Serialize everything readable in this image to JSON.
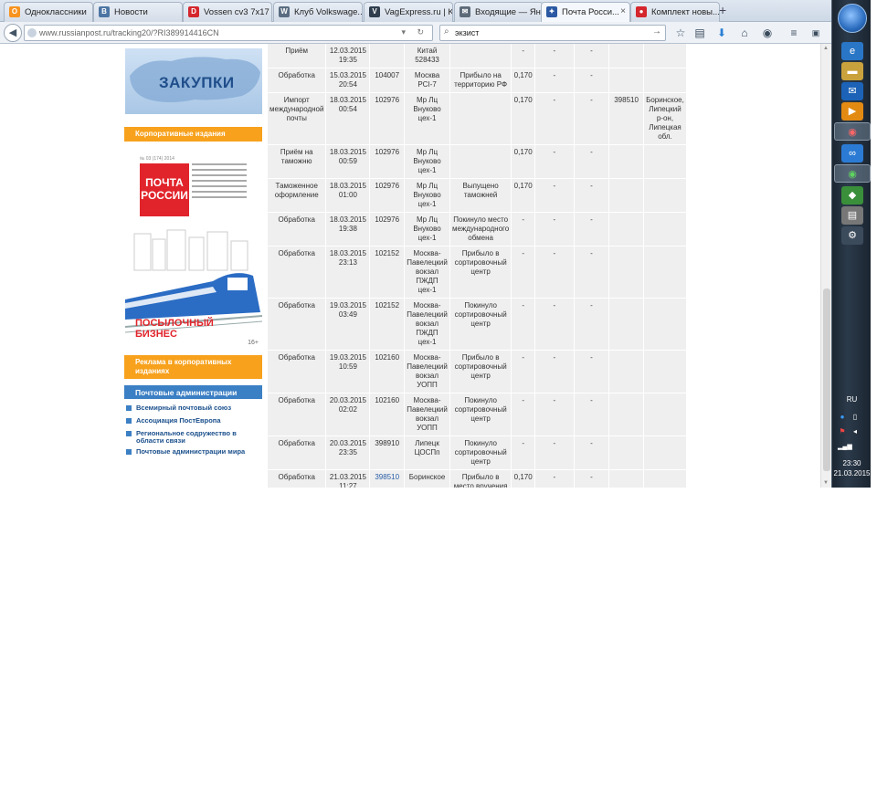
{
  "tabs": [
    {
      "label": "Одноклассники",
      "favicon": "odnoklassniki-icon",
      "fav_color": "#f7931e",
      "fav_glyph": "О"
    },
    {
      "label": "Новости",
      "favicon": "vk-icon",
      "fav_color": "#4c75a3",
      "fav_glyph": "B"
    },
    {
      "label": "Vossen cv3 7x17 ...",
      "favicon": "drive2-icon",
      "fav_color": "#d4262c",
      "fav_glyph": "D"
    },
    {
      "label": "Клуб Volkswage...",
      "favicon": "vw-icon",
      "fav_color": "#5a6c80",
      "fav_glyph": "W"
    },
    {
      "label": "VagExpress.ru | K...",
      "favicon": "vagexpress-icon",
      "fav_color": "#2f3d4d",
      "fav_glyph": "V"
    },
    {
      "label": "Входящие — Ян...",
      "favicon": "mail-icon",
      "fav_color": "#5d6a78",
      "fav_glyph": "✉"
    },
    {
      "label": "Почта Росси...",
      "favicon": "russianpost-icon",
      "fav_color": "#2b59a3",
      "fav_glyph": "✦",
      "active": true
    },
    {
      "label": "Комплект новы...",
      "favicon": "drive2-icon",
      "fav_color": "#d4262c",
      "fav_glyph": "●"
    }
  ],
  "nav": {
    "url": "www.russianpost.ru/tracking20/?RI389914416CN",
    "search": "экзист"
  },
  "sidebar": {
    "zakupki": "ЗАКУПКИ",
    "corp_header": "Корпоративные издания",
    "mag_title": "ПОЧТА РОССИИ",
    "mag_num": "№ 03 (174) 2014",
    "biz_title_1": "ПОСЫЛОЧНЫЙ",
    "biz_title_2": "БИЗНЕС",
    "biz_age": "16+",
    "ads_header": "Реклама в корпоративных изданиях",
    "postal_header": "Почтовые администрации",
    "links": [
      "Всемирный почтовый союз",
      "Ассоциация ПостЕвропа",
      "Региональное содружество в области связи",
      "Почтовые администрации мира"
    ]
  },
  "rows": [
    [
      "Приём",
      "12.03.2015 19:35",
      "",
      "Китай 528433",
      "",
      "-",
      "-",
      "-",
      "",
      ""
    ],
    [
      "Обработка",
      "15.03.2015 20:54",
      "104007",
      "Москва PCI-7",
      "Прибыло на территорию РФ",
      "0,170",
      "-",
      "-",
      "",
      ""
    ],
    [
      "Импорт международной почты",
      "18.03.2015 00:54",
      "102976",
      "Мр Лц Внуково цех-1",
      "",
      "0,170",
      "-",
      "-",
      "398510",
      "Боринское, Липецкий р-он, Липецкая обл."
    ],
    [
      "Приём на таможню",
      "18.03.2015 00:59",
      "102976",
      "Мр Лц Внуково цех-1",
      "",
      "0,170",
      "-",
      "-",
      "",
      ""
    ],
    [
      "Таможенное оформление",
      "18.03.2015 01:00",
      "102976",
      "Мр Лц Внуково цех-1",
      "Выпущено таможней",
      "0,170",
      "-",
      "-",
      "",
      ""
    ],
    [
      "Обработка",
      "18.03.2015 19:38",
      "102976",
      "Мр Лц Внуково цех-1",
      "Покинуло место международного обмена",
      "-",
      "-",
      "-",
      "",
      ""
    ],
    [
      "Обработка",
      "18.03.2015 23:13",
      "102152",
      "Москва-Павелецкий вокзал ПЖДП цех-1",
      "Прибыло в сортировочный центр",
      "-",
      "-",
      "-",
      "",
      ""
    ],
    [
      "Обработка",
      "19.03.2015 03:49",
      "102152",
      "Москва-Павелецкий вокзал ПЖДП цех-1",
      "Покинуло сортировочный центр",
      "-",
      "-",
      "-",
      "",
      ""
    ],
    [
      "Обработка",
      "19.03.2015 10:59",
      "102160",
      "Москва-Павелецкий вокзал УОПП",
      "Прибыло в сортировочный центр",
      "-",
      "-",
      "-",
      "",
      ""
    ],
    [
      "Обработка",
      "20.03.2015 02:02",
      "102160",
      "Москва-Павелецкий вокзал УОПП",
      "Покинуло сортировочный центр",
      "-",
      "-",
      "-",
      "",
      ""
    ],
    [
      "Обработка",
      "20.03.2015 23:35",
      "398910",
      "Липецк ЦОСПп",
      "Покинуло сортировочный центр",
      "-",
      "-",
      "-",
      "",
      ""
    ],
    [
      "Обработка",
      "21.03.2015 11:27",
      "398510",
      "Боринское",
      "Прибыло в место вручения",
      "0,170",
      "-",
      "-",
      "",
      ""
    ]
  ],
  "taskbar": {
    "lang": "RU",
    "time": "23:30",
    "date": "21.03.2015"
  }
}
